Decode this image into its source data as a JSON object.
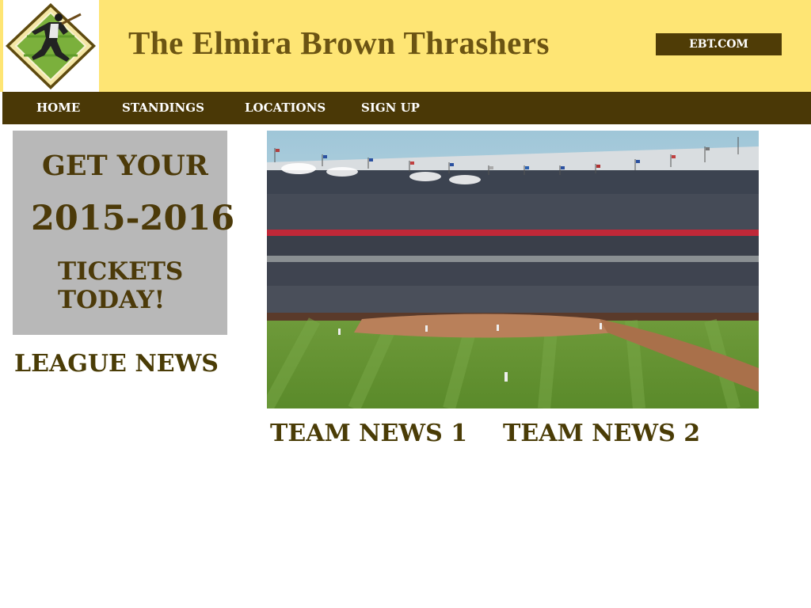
{
  "header": {
    "title": "The Elmira Brown Thrashers",
    "domain_badge": "EBT.COM",
    "logo_icon": "baseball-batter-diamond-logo"
  },
  "nav": {
    "items": [
      {
        "label": "HOME"
      },
      {
        "label": "STANDINGS"
      },
      {
        "label": "LOCATIONS"
      },
      {
        "label": "SIGN UP"
      }
    ]
  },
  "promo": {
    "line1": "GET YOUR",
    "line2": "2015-2016",
    "line3": "TICKETS",
    "line4": "TODAY!"
  },
  "sections": {
    "league_news": "LEAGUE NEWS",
    "team_news_1": "TEAM NEWS 1",
    "team_news_2": "TEAM NEWS 2"
  },
  "hero": {
    "image_icon": "baseball-stadium-photo"
  },
  "colors": {
    "header_bg": "#fee574",
    "nav_bg": "#4a3806",
    "brand_brown": "#4a3c06",
    "promo_bg": "#b8b8b8"
  }
}
